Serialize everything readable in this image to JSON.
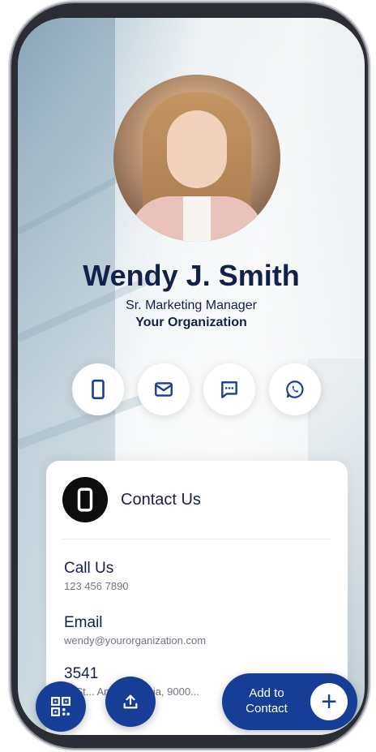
{
  "profile": {
    "name": "Wendy J. Smith",
    "title": "Sr. Marketing Manager",
    "organization": "Your Organization"
  },
  "actions": [
    {
      "icon": "phone-icon"
    },
    {
      "icon": "mail-icon"
    },
    {
      "icon": "message-icon"
    },
    {
      "icon": "whatsapp-icon"
    }
  ],
  "contact_card": {
    "heading": "Contact Us",
    "items": [
      {
        "label": "Call Us",
        "value": "123 456 7890"
      },
      {
        "label": "Email",
        "value": "wendy@yourorganization.com"
      },
      {
        "label": "3541",
        "value": "... St... Am... alifornia, 9000..."
      }
    ]
  },
  "buttons": {
    "add_contact": "Add to Contact",
    "qr_icon": "qr-code-icon",
    "share_icon": "share-icon",
    "plus": "+"
  },
  "colors": {
    "primary": "#173e97",
    "text_dark": "#13204a",
    "text_muted": "#6e7580"
  }
}
